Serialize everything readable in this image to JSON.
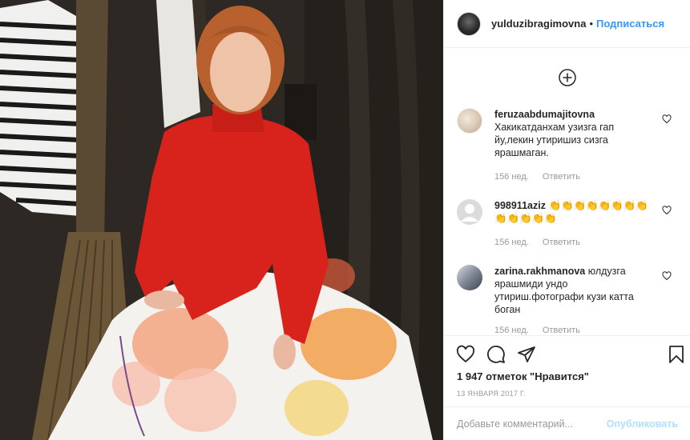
{
  "header": {
    "username": "yulduzibragimovna",
    "separator": "•",
    "follow_label": "Подписаться"
  },
  "comments": [
    {
      "username": "feruzaabdumajitovna",
      "text": "Хакикатданхам узизга гап йу,лекин утиришиз сизга ярашмаган.",
      "age": "156 нед.",
      "reply_label": "Ответить"
    },
    {
      "username": "998911aziz",
      "text": "👏👏👏👏👏👏👏👏👏👏👏👏👏",
      "age": "156 нед.",
      "reply_label": "Ответить"
    },
    {
      "username": "zarina.rakhmanova",
      "text": "юлдузга ярашмиди ундо утириш.фотографи кузи катта боган",
      "age": "156 нед.",
      "reply_label": "Ответить"
    }
  ],
  "actions": {
    "likes_text": "1 947 отметок \"Нравится\"",
    "date": "13 ЯНВАРЯ 2017 Г.",
    "comment_placeholder": "Добавьте комментарий...",
    "post_label": "Опубликовать"
  },
  "icons": {
    "load_more": "plus-circle-icon",
    "like": "heart-icon",
    "comment": "speech-bubble-icon",
    "share": "paper-plane-icon",
    "save": "bookmark-icon"
  },
  "colors": {
    "accent": "#3897f0",
    "muted": "#999999",
    "post_disabled": "#b2dffc"
  }
}
